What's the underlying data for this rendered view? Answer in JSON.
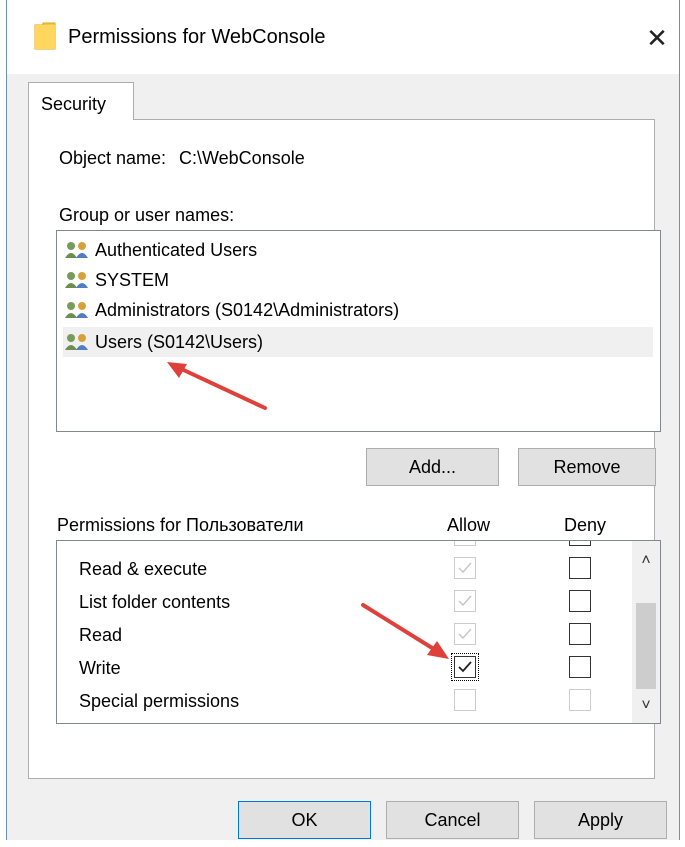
{
  "window": {
    "title": "Permissions for WebConsole",
    "close_glyph": "✕",
    "folder_icon": "folder-icon"
  },
  "tabs": [
    {
      "label": "Security"
    }
  ],
  "object": {
    "label": "Object name:",
    "value": "C:\\WebConsole"
  },
  "groups": {
    "label": "Group or user names:",
    "items": [
      {
        "label": "Authenticated Users",
        "icon": "users-icon"
      },
      {
        "label": "SYSTEM",
        "icon": "users-icon"
      },
      {
        "label": "Administrators (S0142\\Administrators)",
        "icon": "users-icon"
      },
      {
        "label": "Users (S0142\\Users)",
        "icon": "users-icon",
        "selected": true
      }
    ]
  },
  "buttons": {
    "add": "Add...",
    "remove": "Remove",
    "ok": "OK",
    "cancel": "Cancel",
    "apply": "Apply"
  },
  "permissions": {
    "label": "Permissions for Пользователи",
    "allow_header": "Allow",
    "deny_header": "Deny",
    "rows": [
      {
        "name": "Read & execute",
        "allow": "checked-disabled",
        "deny": "unchecked"
      },
      {
        "name": "List folder contents",
        "allow": "checked-disabled",
        "deny": "unchecked"
      },
      {
        "name": "Read",
        "allow": "checked-disabled",
        "deny": "unchecked"
      },
      {
        "name": "Write",
        "allow": "checked",
        "deny": "unchecked"
      },
      {
        "name": "Special permissions",
        "allow": "disabled",
        "deny": "disabled"
      }
    ]
  },
  "scrollbar": {
    "up_glyph": "˄",
    "down_glyph": "˅"
  },
  "colors": {
    "annotation_arrow": "#e0403a",
    "selected_row": "#f0f0f0",
    "button_face": "#e1e1e1"
  }
}
